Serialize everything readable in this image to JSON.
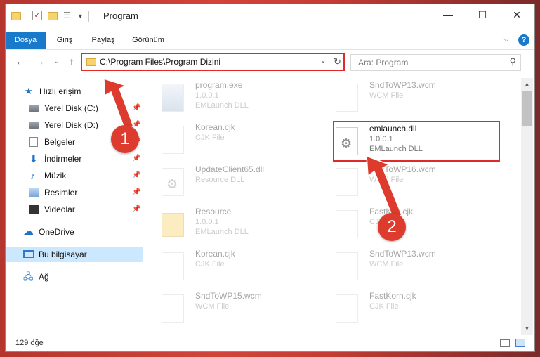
{
  "window": {
    "title": "Program"
  },
  "ribbon": {
    "tabs": [
      "Dosya",
      "Giriş",
      "Paylaş",
      "Görünüm"
    ],
    "help": "?"
  },
  "address": {
    "path": "C:\\Program Files\\Program Dizini"
  },
  "search": {
    "placeholder": "Ara: Program"
  },
  "sidebar": {
    "quick_access": "Hızlı erişim",
    "items": [
      "Yerel Disk (C:)",
      "Yerel Disk (D:)",
      "Belgeler",
      "İndirmeler",
      "Müzik",
      "Resimler",
      "Videolar"
    ],
    "onedrive": "OneDrive",
    "this_pc": "Bu bilgisayar",
    "network": "Ağ"
  },
  "files": {
    "left": [
      {
        "name": "program.exe",
        "line2": "1.0.0.1",
        "line3": "EMLaunch DLL"
      },
      {
        "name": "Korean.cjk",
        "line2": "CJK File",
        "line3": ""
      },
      {
        "name": "UpdateClient65.dll",
        "line2": "Resource DLL",
        "line3": ""
      },
      {
        "name": "Resource",
        "line2": "1.0.0.1",
        "line3": "EMLaunch DLL"
      },
      {
        "name": "Korean.cjk",
        "line2": "CJK File",
        "line3": ""
      },
      {
        "name": "SndToWP15.wcm",
        "line2": "WCM File",
        "line3": ""
      }
    ],
    "right": [
      {
        "name": "SndToWP13.wcm",
        "line2": "WCM File",
        "line3": ""
      },
      {
        "name": "emlaunch.dll",
        "line2": "1.0.0.1",
        "line3": "EMLaunch DLL"
      },
      {
        "name": "SndToWP16.wcm",
        "line2": "WCM File",
        "line3": ""
      },
      {
        "name": "FastKml.cjk",
        "line2": "CJK File",
        "line3": ""
      },
      {
        "name": "SndToWP13.wcm",
        "line2": "WCM File",
        "line3": ""
      },
      {
        "name": "FastKorn.cjk",
        "line2": "CJK File",
        "line3": ""
      }
    ]
  },
  "status": {
    "count": "129 öğe"
  },
  "annotations": {
    "badge1": "1",
    "badge2": "2"
  },
  "colors": {
    "accent": "#1979ca",
    "highlight": "#e02a2a",
    "badge": "#dd3b2d"
  }
}
